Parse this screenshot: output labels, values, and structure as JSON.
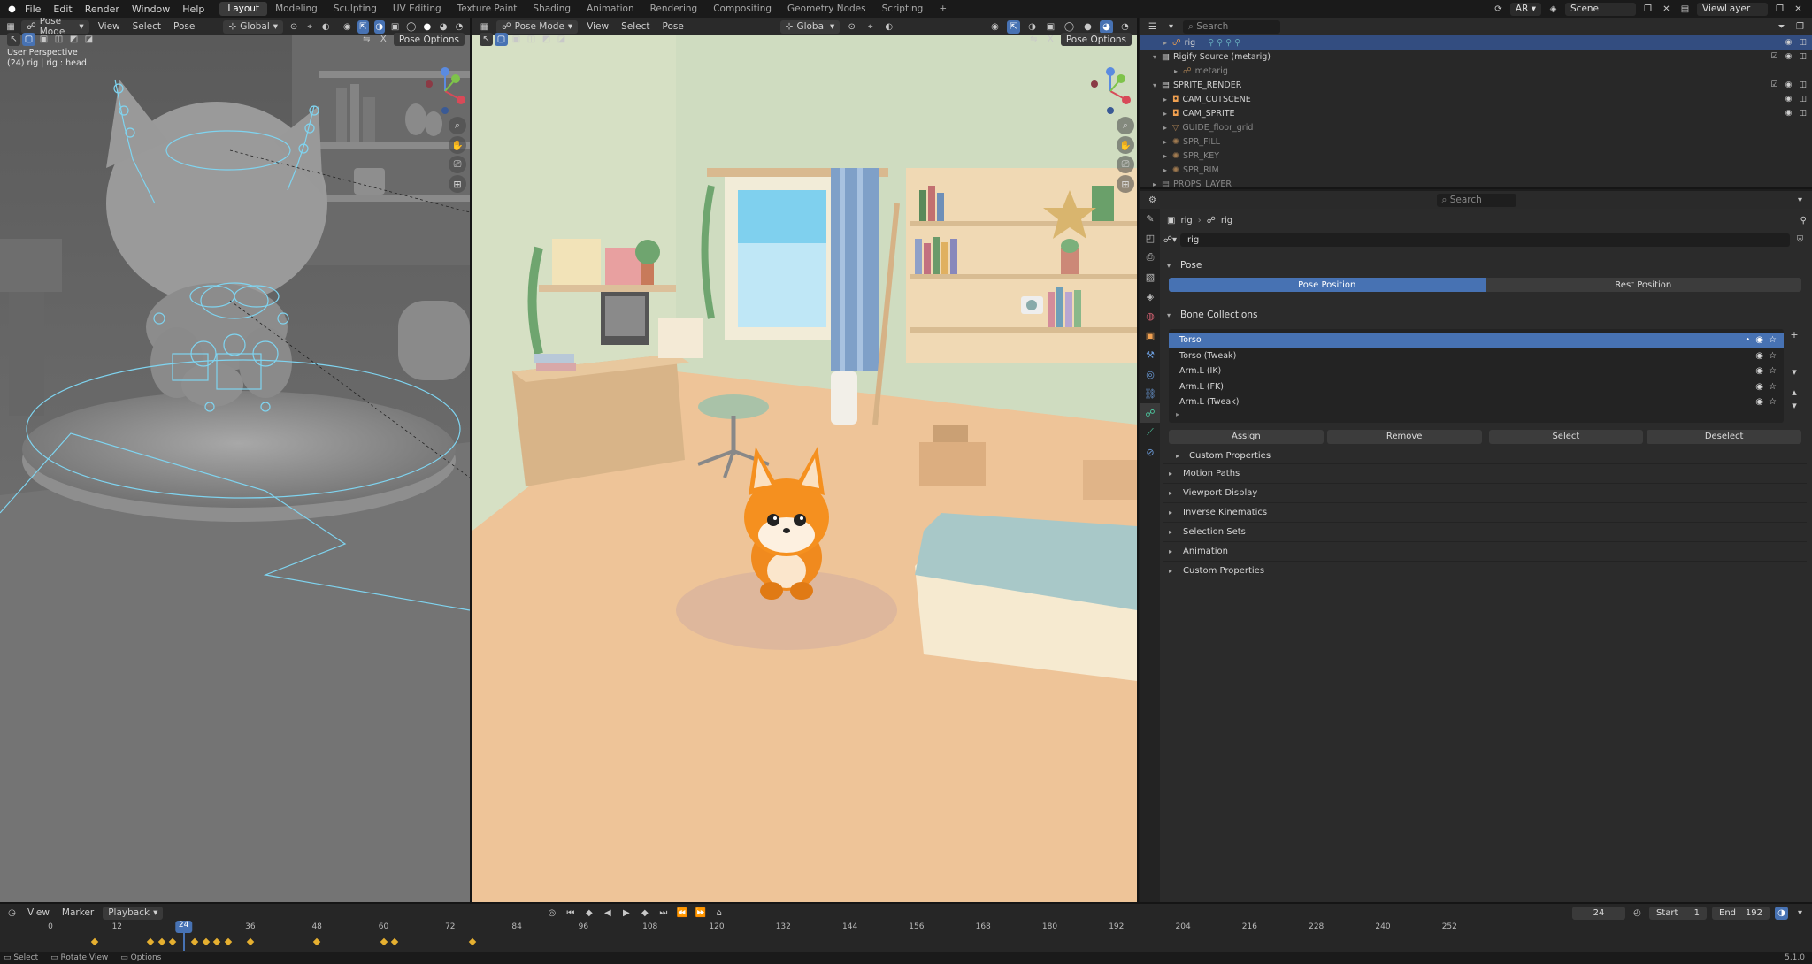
{
  "topbar": {
    "menus": [
      "File",
      "Edit",
      "Render",
      "Window",
      "Help"
    ],
    "workspaces": [
      "Layout",
      "Modeling",
      "Sculpting",
      "UV Editing",
      "Texture Paint",
      "Shading",
      "Animation",
      "Rendering",
      "Compositing",
      "Geometry Nodes",
      "Scripting"
    ],
    "active_workspace": "Layout",
    "add_label": "+",
    "ar_label": "AR",
    "scene_label": "Scene",
    "viewlayer_label": "ViewLayer"
  },
  "viewport_left": {
    "mode": "Pose Mode",
    "menus": [
      "View",
      "Select",
      "Pose"
    ],
    "orientation": "Global",
    "pose_options": "Pose Options",
    "overlay_line1": "User Perspective",
    "overlay_line2": "(24) rig | rig : head",
    "gizmo": {
      "z": "Z",
      "y": "Y",
      "x": "X"
    }
  },
  "viewport_right": {
    "mode": "Pose Mode",
    "menus": [
      "View",
      "Select",
      "Pose"
    ],
    "orientation": "Global",
    "pose_options": "Pose Options",
    "gizmo": {
      "z": "Z",
      "y": "Y",
      "x": "X"
    }
  },
  "outliner": {
    "search_placeholder": "Search",
    "rows": [
      {
        "label": "rig",
        "indent": 1,
        "selected": true
      },
      {
        "label": "Rigify Source (metarig)",
        "indent": 1,
        "selected": false
      },
      {
        "label": "metarig",
        "indent": 2,
        "selected": false,
        "dim": true
      },
      {
        "label": "SPRITE_RENDER",
        "indent": 1,
        "selected": false
      },
      {
        "label": "CAM_CUTSCENE",
        "indent": 2,
        "selected": false
      },
      {
        "label": "CAM_SPRITE",
        "indent": 2,
        "selected": false
      },
      {
        "label": "GUIDE_floor_grid",
        "indent": 2,
        "selected": false,
        "dim": true
      },
      {
        "label": "SPR_FILL",
        "indent": 2,
        "selected": false,
        "dim": true
      },
      {
        "label": "SPR_KEY",
        "indent": 2,
        "selected": false,
        "dim": true
      },
      {
        "label": "SPR_RIM",
        "indent": 2,
        "selected": false,
        "dim": true
      },
      {
        "label": "PROPS_LAYER",
        "indent": 1,
        "selected": false,
        "dim": true
      }
    ]
  },
  "properties": {
    "search_placeholder": "Search",
    "breadcrumb": [
      "rig",
      "rig"
    ],
    "datablock_name": "rig",
    "pose_section": "Pose",
    "pose_position": "Pose Position",
    "rest_position": "Rest Position",
    "bone_collections_section": "Bone Collections",
    "bone_collections": [
      "Torso",
      "Torso (Tweak)",
      "Arm.L (IK)",
      "Arm.L (FK)",
      "Arm.L (Tweak)"
    ],
    "assign": "Assign",
    "remove": "Remove",
    "select": "Select",
    "deselect": "Deselect",
    "custom_props_inner": "Custom Properties",
    "subpanels": [
      "Motion Paths",
      "Viewport Display",
      "Inverse Kinematics",
      "Selection Sets",
      "Animation",
      "Custom Properties"
    ]
  },
  "timeline": {
    "menus": [
      "View",
      "Marker",
      "Playback"
    ],
    "current_frame": "24",
    "start_label": "Start",
    "start_value": "1",
    "end_label": "End",
    "end_value": "192",
    "ticks": [
      "0",
      "12",
      "24",
      "36",
      "48",
      "60",
      "72",
      "84",
      "96",
      "108",
      "120",
      "132",
      "144",
      "156",
      "168",
      "180",
      "192",
      "204",
      "216",
      "228",
      "240",
      "252"
    ]
  },
  "statusbar": {
    "items": [
      "Select",
      "Rotate View",
      "Options"
    ],
    "version": "5.1.0"
  }
}
